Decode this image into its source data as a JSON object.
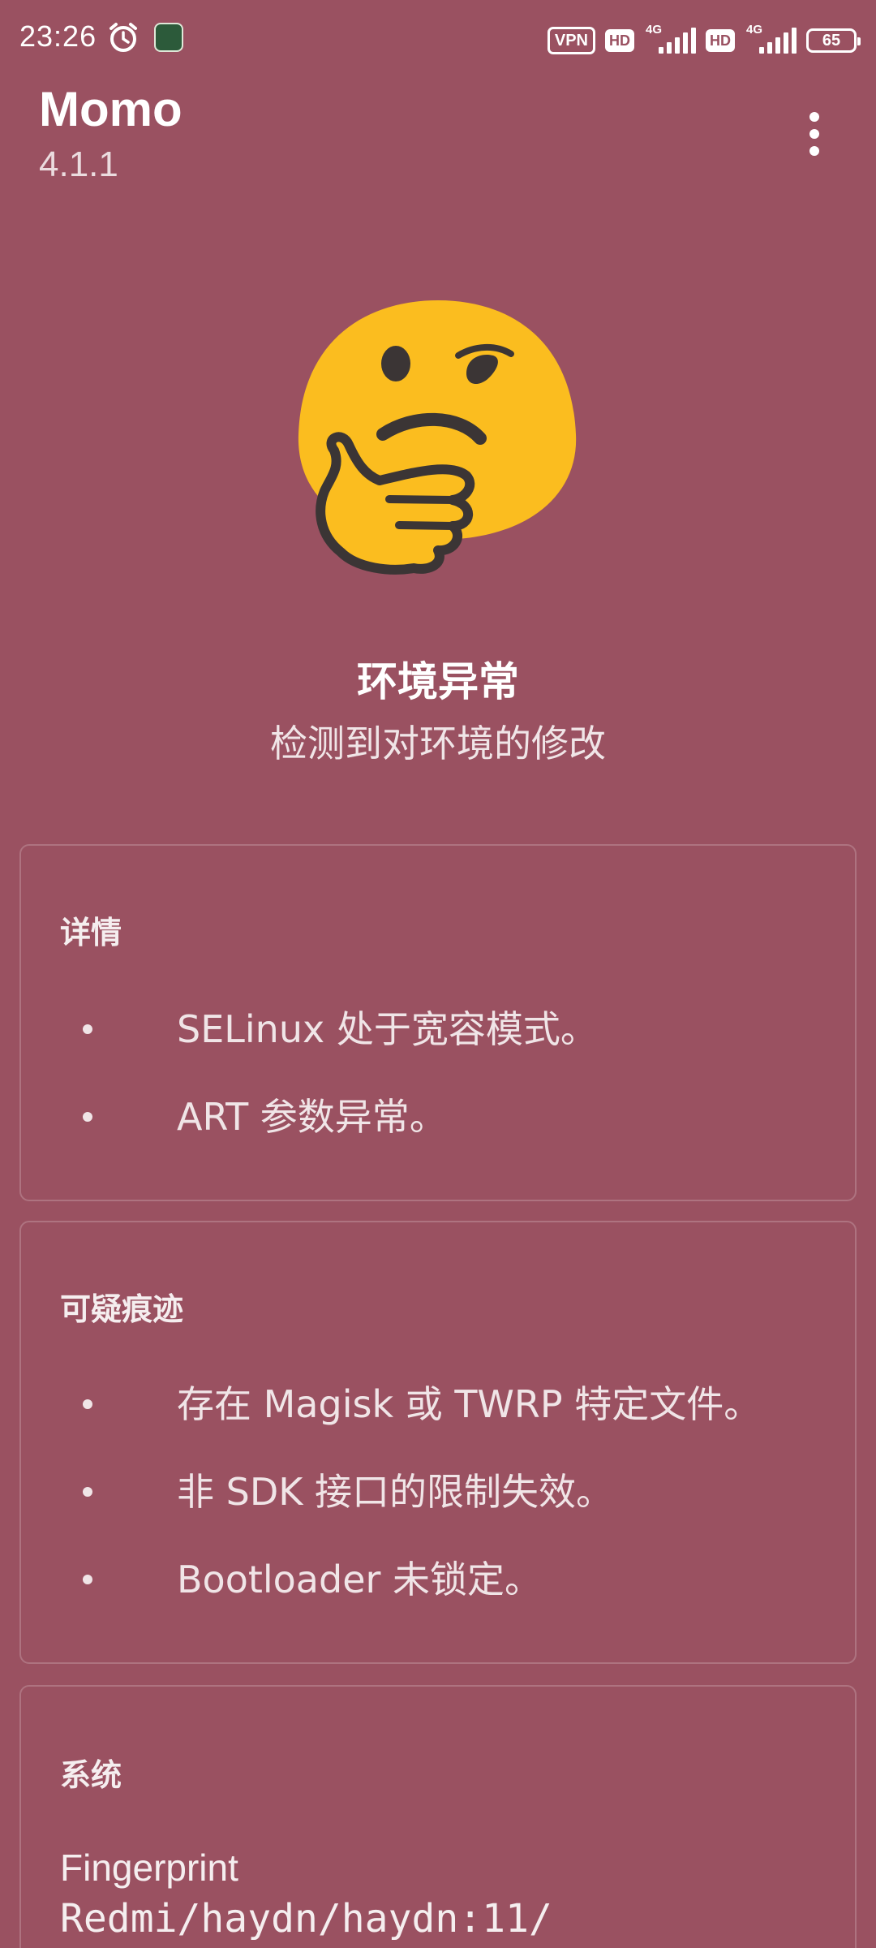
{
  "status_bar": {
    "time": "23:26",
    "vpn": "VPN",
    "hd1": "HD",
    "net1": "4G",
    "hd2": "HD",
    "net2": "4G",
    "battery": "65"
  },
  "app": {
    "title": "Momo",
    "version": "4.1.1"
  },
  "environment": {
    "emoji": "thinking-face",
    "title": "环境异常",
    "subtitle": "检测到对环境的修改"
  },
  "details_card": {
    "title": "详情",
    "items": [
      "SELinux 处于宽容模式。",
      "ART 参数异常。"
    ]
  },
  "traces_card": {
    "title": "可疑痕迹",
    "items": [
      "存在 Magisk 或 TWRP 特定文件。",
      "非 SDK 接口的限制失效。",
      "Bootloader 未锁定。"
    ]
  },
  "system_card": {
    "title": "系统",
    "fingerprint_label": "Fingerprint",
    "fingerprint_value": "Redmi/haydn/haydn:11/"
  },
  "colors": {
    "background": "#9a5161",
    "emoji_face": "#fbbd1f",
    "emoji_outline": "#3b3535"
  }
}
